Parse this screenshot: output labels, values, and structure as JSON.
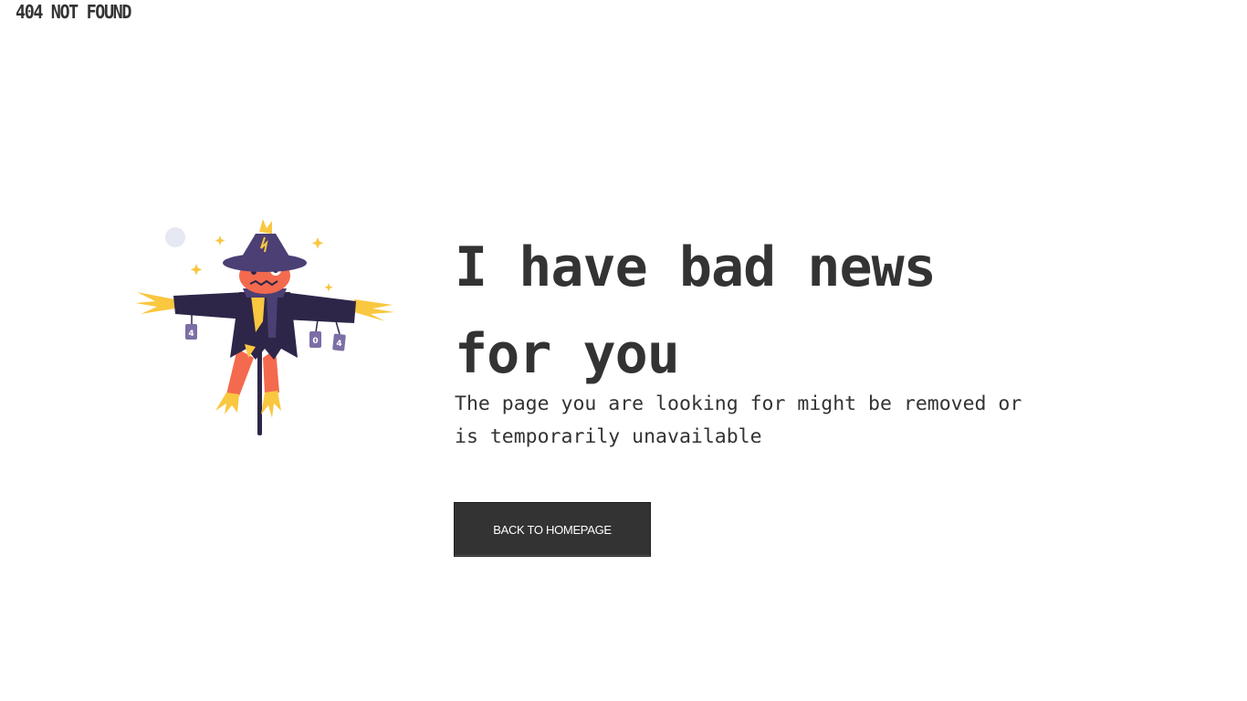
{
  "header": {
    "brand": "404 NOT FOUND"
  },
  "illustration": {
    "icon": "scarecrow-illustration",
    "sign_texts": [
      "4",
      "0",
      "4"
    ],
    "colors": {
      "coat": "#2e2648",
      "hat": "#4b3f74",
      "face": "#f46a4e",
      "straw": "#f9c740",
      "sign": "#7c6ea6",
      "moon": "#e6e8f3"
    }
  },
  "main": {
    "headline_line1": "I have bad news",
    "headline_line2": "for you",
    "subtext_line1": "The page you are looking for might be removed or",
    "subtext_line2": "is temporarily unavailable",
    "button_label": "BACK TO HOMEPAGE"
  },
  "colors": {
    "text": "#333333",
    "button_bg": "#333333",
    "button_text": "#ffffff",
    "background": "#ffffff"
  }
}
